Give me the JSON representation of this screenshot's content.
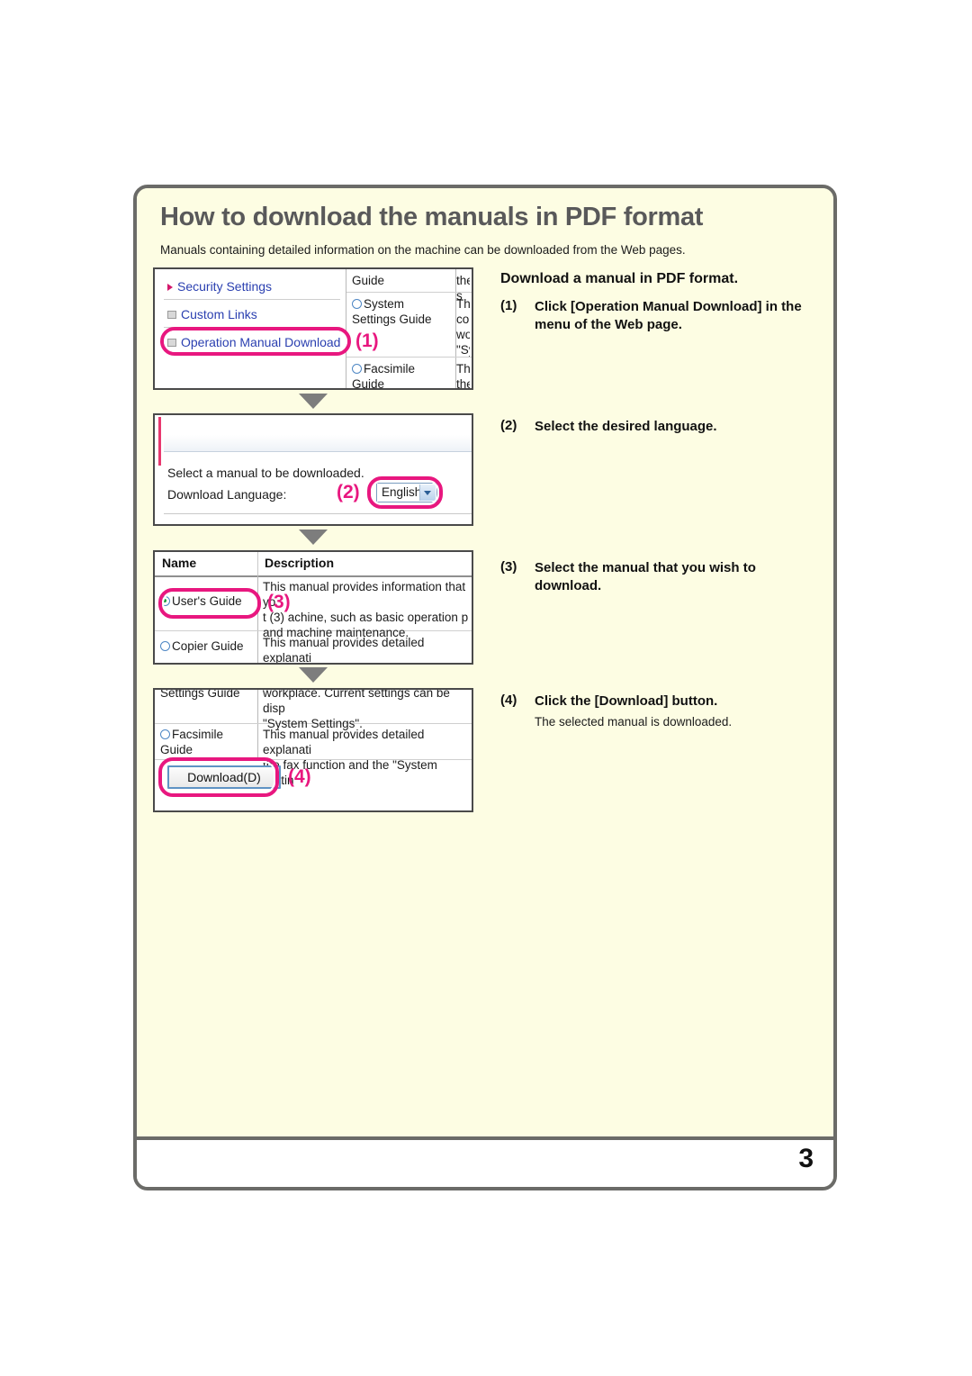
{
  "page": {
    "title": "How to download the manuals in PDF format",
    "intro": "Manuals containing detailed information on the machine can be downloaded from the Web pages.",
    "page_number": "3",
    "accent_color": "#e8177f",
    "frame_color": "#6b6b68",
    "background_color": "#fdfde3",
    "title_color": "#59595a"
  },
  "instructions": {
    "heading": "Download a manual in PDF format.",
    "steps": [
      {
        "number": "(1)",
        "text": "Click [Operation Manual Download] in the menu of the Web page.",
        "sub": ""
      },
      {
        "number": "(2)",
        "text": "Select the desired language.",
        "sub": ""
      },
      {
        "number": "(3)",
        "text": "Select the manual that you wish to download.",
        "sub": ""
      },
      {
        "number": "(4)",
        "text": "Click the [Download] button.",
        "sub": "The selected manual is downloaded."
      }
    ]
  },
  "screenshots": {
    "shot1": {
      "callout": "(1)",
      "menu_items": [
        {
          "label": "Security Settings",
          "bullet": "triangle-bullet-icon"
        },
        {
          "label": "Custom Links",
          "bullet": "square-bullet-icon"
        },
        {
          "label": "Operation Manual Download",
          "bullet": "square-bullet-icon"
        }
      ],
      "fragment_rows": [
        {
          "name": "Guide",
          "desc": "the s"
        },
        {
          "name": "System\nSettings Guide",
          "desc": "This\nconfi\nwork\n\"Sys"
        },
        {
          "name": "Facsimile\nGuide",
          "desc": "This\nthe f"
        }
      ]
    },
    "shot2": {
      "callout": "(2)",
      "line1": "Select a manual to be downloaded.",
      "label": "Download Language:",
      "selected_language": "English"
    },
    "shot3": {
      "callout": "(3)",
      "columns": [
        "Name",
        "Description"
      ],
      "rows": [
        {
          "name": "User's Guide",
          "selected": true,
          "desc": "This manual provides information that yo\nt (3) achine, such as basic operation p\nand machine maintenance."
        },
        {
          "name": "Copier Guide",
          "selected": false,
          "desc": "This manual provides detailed explanati\nthe copy function."
        }
      ]
    },
    "shot4": {
      "callout": "(4)",
      "rows": [
        {
          "name": "Settings Guide",
          "selected": false,
          "desc": "workplace. Current settings can be disp\n\"System Settings\"."
        },
        {
          "name": "Facsimile\nGuide",
          "selected": false,
          "desc": "This manual provides detailed explanati\nthe fax function and the \"System Settin"
        }
      ],
      "download_button": "Download(D)"
    }
  }
}
